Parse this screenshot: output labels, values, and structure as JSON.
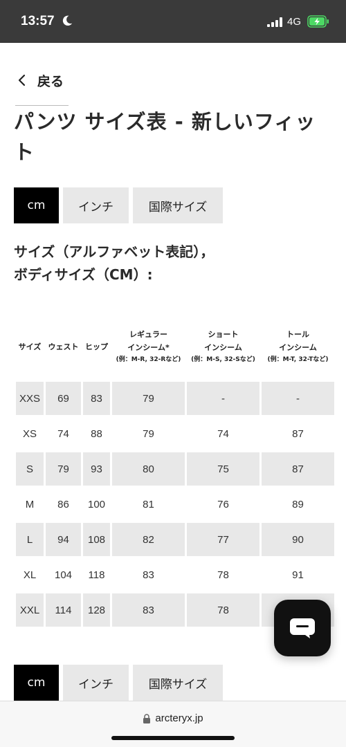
{
  "status_bar": {
    "time": "13:57",
    "network": "4G",
    "icons": [
      "moon-icon",
      "signal-icon",
      "battery-charging-icon"
    ]
  },
  "nav": {
    "back_label": "戻る"
  },
  "page": {
    "title": "パンツ サイズ表 - 新しいフィット"
  },
  "unit_tabs": [
    "cm",
    "インチ",
    "国際サイズ"
  ],
  "active_tab": "cm",
  "section": {
    "heading_line1": "サイズ（アルファベット表記），",
    "heading_line2": "ボディサイズ（CM）:"
  },
  "table": {
    "headers": {
      "size": "サイズ",
      "waist": "ウェスト",
      "hip": "ヒップ",
      "regular": {
        "line1": "レギュラー",
        "line2": "インシーム*",
        "note": "(例：M-R, 32-Rなど)"
      },
      "short": {
        "line1": "ショート",
        "line2": "インシーム",
        "note": "(例：M-S, 32-Sなど)"
      },
      "tall": {
        "line1": "トール",
        "line2": "インシーム",
        "note": "(例：M-T, 32-Tなど)"
      }
    },
    "rows": [
      [
        "XXS",
        "69",
        "83",
        "79",
        "-",
        "-"
      ],
      [
        "XS",
        "74",
        "88",
        "79",
        "74",
        "87"
      ],
      [
        "S",
        "79",
        "93",
        "80",
        "75",
        "87"
      ],
      [
        "M",
        "86",
        "100",
        "81",
        "76",
        "89"
      ],
      [
        "L",
        "94",
        "108",
        "82",
        "77",
        "90"
      ],
      [
        "XL",
        "104",
        "118",
        "83",
        "78",
        "91"
      ],
      [
        "XXL",
        "114",
        "128",
        "83",
        "78",
        ""
      ]
    ]
  },
  "chat": {
    "icon": "chat-bubble-icon"
  },
  "browser": {
    "url": "arcteryx.jp",
    "icon": "lock-icon"
  },
  "colors": {
    "status_bar": "#3a3a3a",
    "tab_active": "#000000",
    "tab_inactive": "#e8e8e8",
    "row_shade": "#e8e8e8",
    "battery": "#4cd964"
  }
}
